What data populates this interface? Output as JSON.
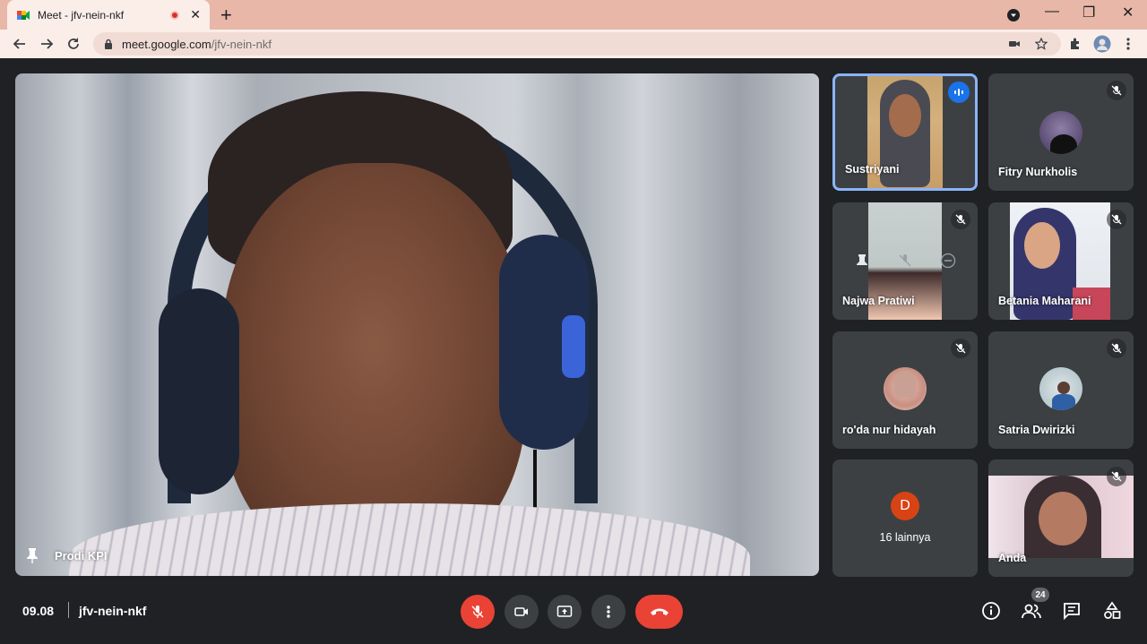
{
  "browser": {
    "tab_title": "Meet - jfv-nein-nkf",
    "tab_close": "✕",
    "new_tab": "+",
    "url_host": "meet.google.com",
    "url_path": "/jfv-nein-nkf",
    "win_minimize": "—",
    "win_restore": "❐",
    "win_close": "✕"
  },
  "main": {
    "presenter_name": "Prodi KPI"
  },
  "tiles": [
    {
      "name": "Sustriyani",
      "state": "speaking"
    },
    {
      "name": "Fitry Nurkholis",
      "state": "muted"
    },
    {
      "name": "Najwa Pratiwi",
      "state": "muted"
    },
    {
      "name": "Betania Maharani",
      "state": "muted"
    },
    {
      "name": "ro'da nur hidayah",
      "state": "muted"
    },
    {
      "name": "Satria Dwirizki",
      "state": "muted"
    },
    {
      "letter": "D",
      "label": "16 lainnya"
    },
    {
      "name": "Anda",
      "state": "muted"
    }
  ],
  "bottom": {
    "time": "09.08",
    "meeting_code": "jfv-nein-nkf",
    "participant_count": "24"
  },
  "colors": {
    "accent": "#8ab4f8",
    "danger": "#ea4335",
    "speaking": "#1a73e8"
  }
}
